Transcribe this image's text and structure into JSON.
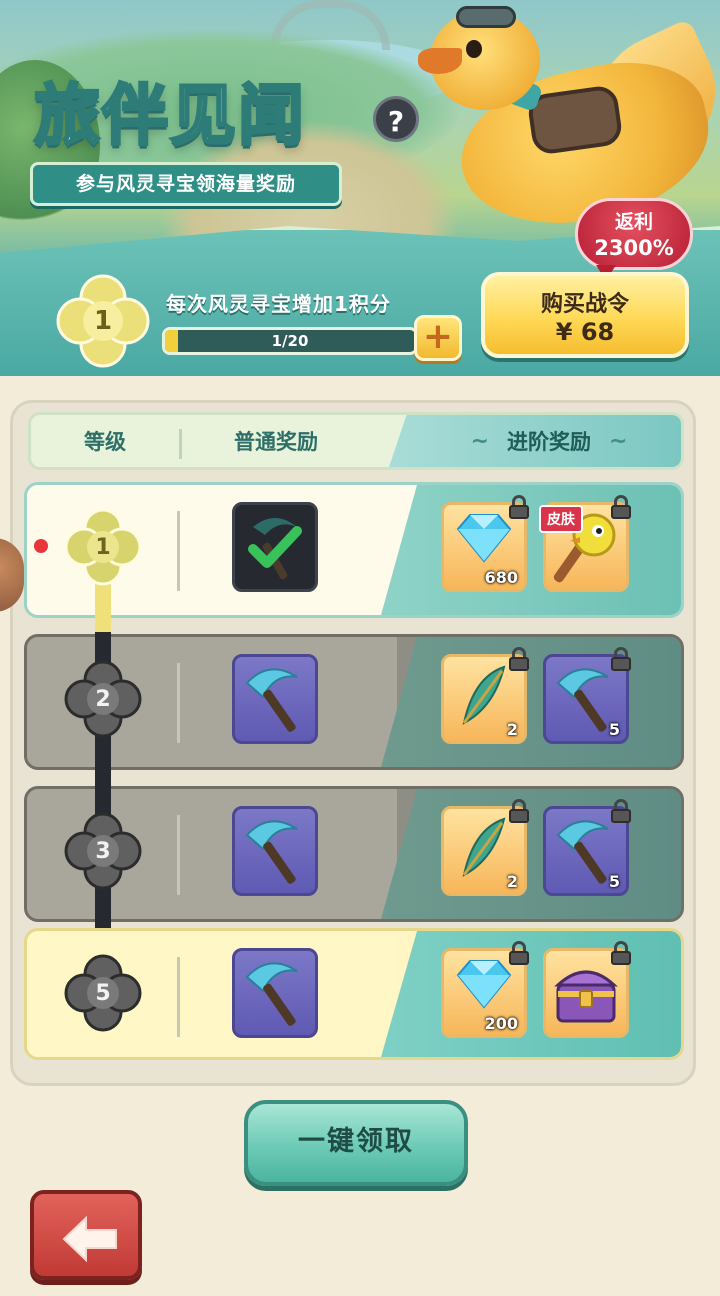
{
  "banner": {
    "title_part1": "旅伴",
    "title_part2": "见闻",
    "subtitle": "参与风灵寻宝领海量奖励",
    "help_label": "?"
  },
  "progress": {
    "level": "1",
    "text": "每次风灵寻宝增加1积分",
    "label": "1/20",
    "current": 1,
    "max": 20,
    "plus_label": "+"
  },
  "buy": {
    "title": "购买战令",
    "price": "¥ 68",
    "rebate_line1": "返利",
    "rebate_line2": "2300%"
  },
  "table_header": {
    "level": "等级",
    "normal": "普通奖励",
    "advanced": "进阶奖励"
  },
  "rows": [
    {
      "level": "1",
      "normal_item": {
        "icon": "scythe-claimed-icon",
        "claimed": true
      },
      "advanced_items": [
        {
          "icon": "diamond-icon",
          "count": "680",
          "locked": true
        },
        {
          "icon": "bird-staff-skin-icon",
          "tag": "皮肤",
          "locked": true
        }
      ]
    },
    {
      "level": "2",
      "normal_item": {
        "icon": "scythe-icon"
      },
      "advanced_items": [
        {
          "icon": "feather-icon",
          "count": "2",
          "locked": true
        },
        {
          "icon": "scythe-icon",
          "count": "5",
          "locked": true
        }
      ]
    },
    {
      "level": "3",
      "normal_item": {
        "icon": "scythe-icon"
      },
      "advanced_items": [
        {
          "icon": "feather-icon",
          "count": "2",
          "locked": true
        },
        {
          "icon": "scythe-icon",
          "count": "5",
          "locked": true
        }
      ]
    },
    {
      "level": "5",
      "normal_item": {
        "icon": "scythe-icon"
      },
      "advanced_items": [
        {
          "icon": "diamond-icon",
          "count": "200",
          "locked": true
        },
        {
          "icon": "treasure-chest-icon",
          "locked": true
        }
      ]
    }
  ],
  "actions": {
    "claim_all": "一键领取",
    "back_icon": "back-arrow-icon"
  },
  "colors": {
    "teal": "#4aa9a3",
    "gold": "#ffd957",
    "red_badge": "#b71f35",
    "panel": "#e8e3d2"
  }
}
